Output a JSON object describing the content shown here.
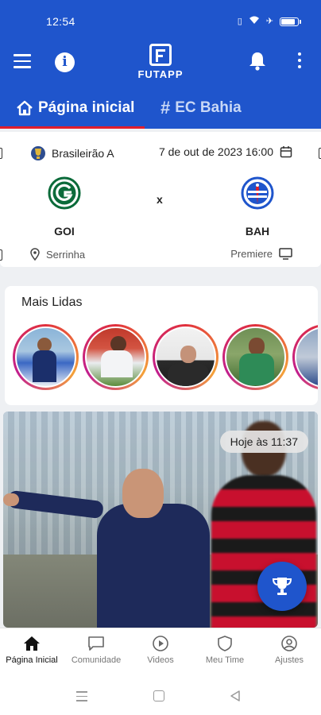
{
  "status_bar": {
    "time": "12:54"
  },
  "app_bar": {
    "logo_text": "FUTAPP"
  },
  "tabs": [
    {
      "label": "Página inicial",
      "active": true
    },
    {
      "label": "EC Bahia",
      "active": false
    }
  ],
  "match": {
    "competition": "Brasileirão A",
    "datetime": "7 de out de 2023 16:00",
    "home": {
      "code": "GOI",
      "color": "#0b6b3a"
    },
    "away": {
      "code": "BAH",
      "color": "#1f55cc"
    },
    "vs": "x",
    "venue": "Serrinha",
    "broadcast": "Premiere"
  },
  "mais_lidas": {
    "title": "Mais Lidas",
    "story_count": 5
  },
  "news": {
    "timestamp": "Hoje às 11:37"
  },
  "bottom_nav": [
    {
      "label": "Página Inicial",
      "icon": "home-icon",
      "active": true
    },
    {
      "label": "Comunidade",
      "icon": "chat-icon",
      "active": false
    },
    {
      "label": "Videos",
      "icon": "play-icon",
      "active": false
    },
    {
      "label": "Meu Time",
      "icon": "shield-icon",
      "active": false
    },
    {
      "label": "Ajustes",
      "icon": "user-settings-icon",
      "active": false
    }
  ],
  "colors": {
    "primary": "#1f55cc",
    "tab_indicator": "#e11d2b"
  }
}
